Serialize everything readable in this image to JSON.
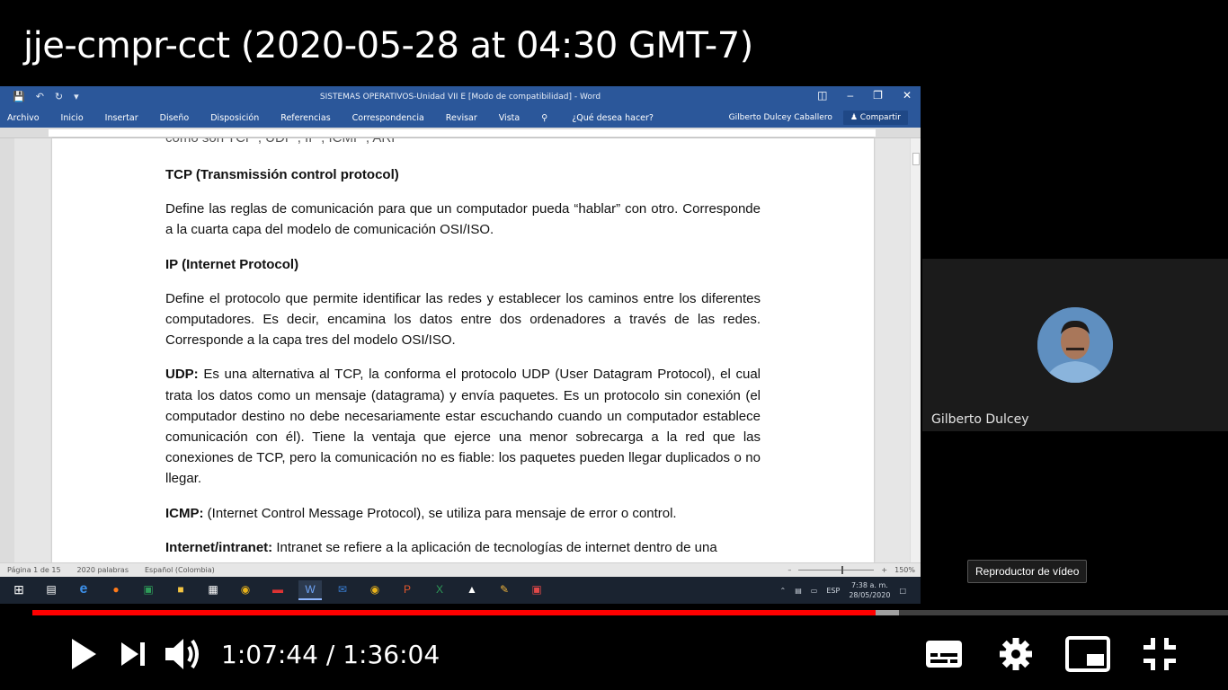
{
  "video": {
    "title": "jje-cmpr-cct (2020-05-28 at 04:30 GMT-7)",
    "current_time": "1:07:44",
    "separator": "/",
    "duration": "1:36:04",
    "progress_fraction": 0.705,
    "buffered_fraction": 0.725,
    "accent_color": "#ff0000"
  },
  "word": {
    "window_title": "SISTEMAS OPERATIVOS-Unidad VII E [Modo de compatibilidad] - Word",
    "tabs": [
      "Archivo",
      "Inicio",
      "Insertar",
      "Diseño",
      "Disposición",
      "Referencias",
      "Correspondencia",
      "Revisar",
      "Vista"
    ],
    "tell_me": "¿Qué desea hacer?",
    "user": "Gilberto Dulcey Caballero",
    "share": "Compartir",
    "ribbon_color": "#2b579a",
    "doc_top": "como son TCP , UDP , IP , ICMP , ARP",
    "paragraphs": {
      "tcp_head": "TCP (Transmissión  control protocol)",
      "tcp_body": "Define las reglas de comunicación para que un computador pueda “hablar” con otro. Corresponde a la cuarta capa del modelo de comunicación OSI/ISO.",
      "ip_head": "IP (Internet Protocol)",
      "ip_body": "Define el protocolo que permite identificar las redes y establecer los caminos entre los diferentes computadores. Es decir, encamina los datos entre dos ordenadores a través de las redes. Corresponde a la capa tres del modelo OSI/ISO.",
      "udp_label": "UDP:",
      "udp_body": " Es una alternativa al TCP, la conforma el protocolo UDP (User Datagram Protocol), el cual trata los datos como un mensaje (datagrama) y envía paquetes. Es un protocolo sin conexión (el computador destino no debe necesariamente estar escuchando cuando un computador establece comunicación con él). Tiene la ventaja que ejerce una menor sobrecarga a la red que las conexiones de TCP, pero la comunicación no es fiable: los paquetes pueden llegar duplicados o no llegar.",
      "icmp_label": "ICMP:",
      "icmp_body": " (Internet Control Message Protocol), se utiliza para mensaje de error o control.",
      "inet_label": "Internet/intranet:",
      "inet_body": " Intranet se refiere a la aplicación de tecnologías de internet dentro de una"
    },
    "status": {
      "page": "Página 1 de 15",
      "words": "2020 palabras",
      "language": "Español (Colombia)",
      "zoom": "150%"
    }
  },
  "taskbar": {
    "lang": "ESP",
    "time": "7:38 a. m.",
    "date": "28/05/2020"
  },
  "participant": {
    "name": "Gilberto Dulcey"
  },
  "tooltip": "Reproductor de vídeo"
}
